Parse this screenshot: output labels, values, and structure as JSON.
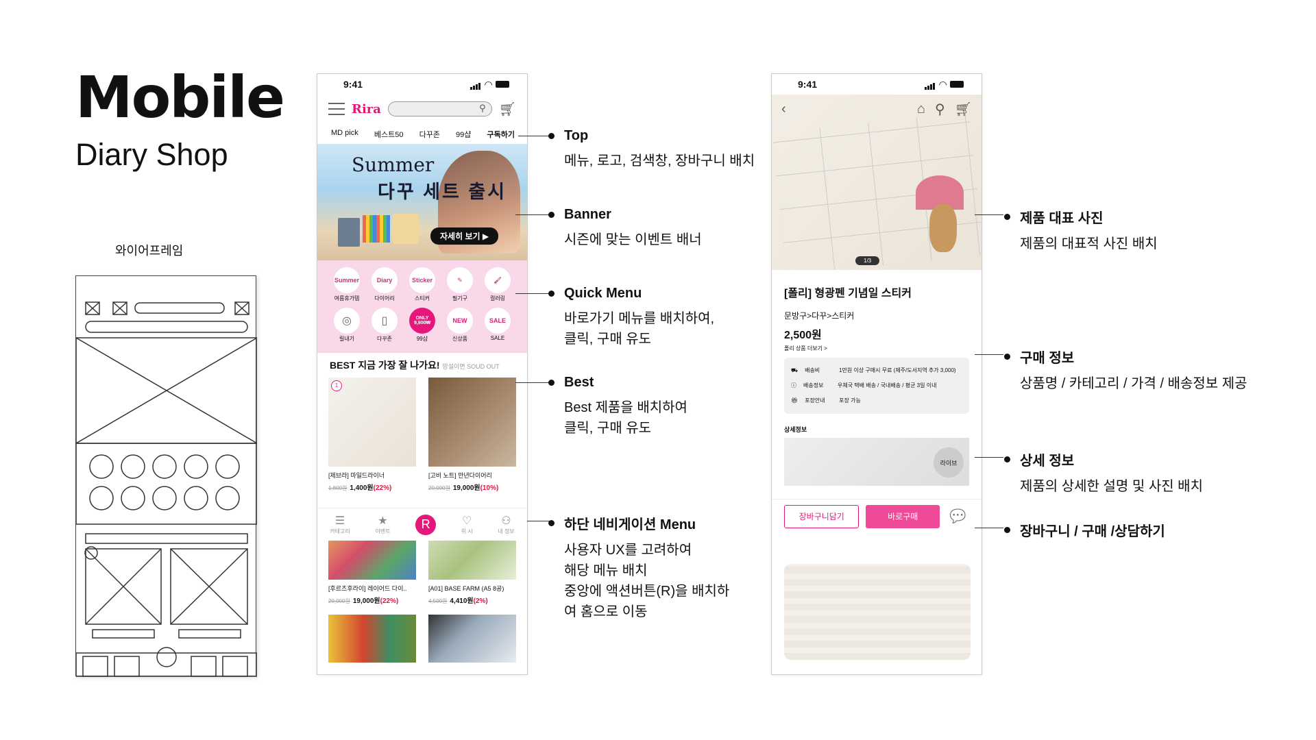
{
  "heading": {
    "title": "Mobile",
    "subtitle": "Diary Shop",
    "wireframe_label": "와이어프레임"
  },
  "phone1": {
    "time": "9:41",
    "logo": "Rira",
    "nav": [
      "MD pick",
      "베스트50",
      "다꾸존",
      "99샵",
      "구독하기"
    ],
    "banner": {
      "line1": "Summer",
      "line2": "다꾸 세트 출시",
      "button": "자세히 보기 ▶"
    },
    "quick_row1": [
      {
        "icon": "Summer",
        "label": "여름휴가템"
      },
      {
        "icon": "Diary",
        "label": "다이어리"
      },
      {
        "icon": "Sticker",
        "label": "스티커"
      },
      {
        "icon": "pen-icon",
        "label": "필기구"
      },
      {
        "icon": "brush-icon",
        "label": "컬러링"
      }
    ],
    "quick_row2": [
      {
        "icon": "instagram-icon",
        "label": "릴내기"
      },
      {
        "icon": "book-icon",
        "label": "다꾸존"
      },
      {
        "icon": "ONLY 9,900₩",
        "label": "99샵"
      },
      {
        "icon": "NEW",
        "label": "신상품"
      },
      {
        "icon": "SALE",
        "label": "SALE"
      }
    ],
    "best": {
      "title": "BEST 지금 가장 잘 나가요!",
      "sub": "망설이면 SOUD OUT"
    },
    "products": [
      {
        "name": "[제브라] 마일드라이너",
        "old": "1,800원",
        "price": "1,400원",
        "rate": "(22%)"
      },
      {
        "name": "[고비 노트] 만년다이어리",
        "old": "20,000원",
        "price": "19,000원",
        "rate": "(10%)"
      },
      {
        "name": "[후르츠후라이] 레이어드 다이..",
        "old": "20,000원",
        "price": "19,000원",
        "rate": "(22%)"
      },
      {
        "name": "[A01] BASE FARM (A5 8공)",
        "old": "4,500원",
        "price": "4,410원",
        "rate": "(2%)"
      }
    ],
    "tabbar": [
      {
        "icon": "menu-icon",
        "label": "카테고리"
      },
      {
        "icon": "star-icon",
        "label": "이벤트"
      },
      {
        "icon": "R",
        "label": ""
      },
      {
        "icon": "heart-icon",
        "label": "위 시"
      },
      {
        "icon": "user-icon",
        "label": "내 정보"
      }
    ],
    "badge": "1"
  },
  "annotations": [
    {
      "title": "Top",
      "body": [
        "메뉴, 로고, 검색창, 장바구니 배치"
      ]
    },
    {
      "title": "Banner",
      "body": [
        "시즌에 맞는 이벤트 배너"
      ]
    },
    {
      "title": "Quick Menu",
      "body": [
        "바로가기 메뉴를 배치하여,",
        "클릭, 구매 유도"
      ]
    },
    {
      "title": "Best",
      "body": [
        "Best 제품을 배치하여",
        "클릭, 구매 유도"
      ]
    },
    {
      "title": "하단  네비게이션 Menu",
      "body": [
        "사용자 UX를 고려하여",
        "해당 메뉴 배치",
        "중앙에 액션버튼(R)을 배치하",
        "여 홈으로 이동"
      ]
    }
  ],
  "phone2": {
    "time": "9:41",
    "pager": "1/3",
    "product_name": "[폴리] 형광펜 기념일 스티커",
    "category": "문방구>다꾸>스티커",
    "price": "2,500원",
    "more": "폴리 상품 더보기 >",
    "ship": [
      {
        "icon": "truck-icon",
        "label": "배송비",
        "value": "1만원 이상 구매시 무료 (제주/도서지역 추가 3,000)"
      },
      {
        "icon": "info-icon",
        "label": "배송정보",
        "value": "우체국 택배 배송 / 국내배송 / 평균 3일 이내"
      },
      {
        "icon": "gift-icon",
        "label": "포장안내",
        "value": "포장 가능"
      }
    ],
    "detail": "상세정보",
    "live": "라이브",
    "cart_btn": "장바구니담기",
    "buy_btn": "바로구매"
  },
  "annotations2": [
    {
      "title": "제품 대표 사진",
      "body": [
        "제품의 대표적 사진 배치"
      ]
    },
    {
      "title": "구매 정보",
      "body": [
        "상품명 / 카테고리 / 가격 / 배송정보 제공"
      ]
    },
    {
      "title": "상세 정보",
      "body": [
        "제품의 상세한 설명 및 사진 배치"
      ]
    },
    {
      "title": "장바구니 / 구매 /상담하기",
      "body": []
    }
  ]
}
